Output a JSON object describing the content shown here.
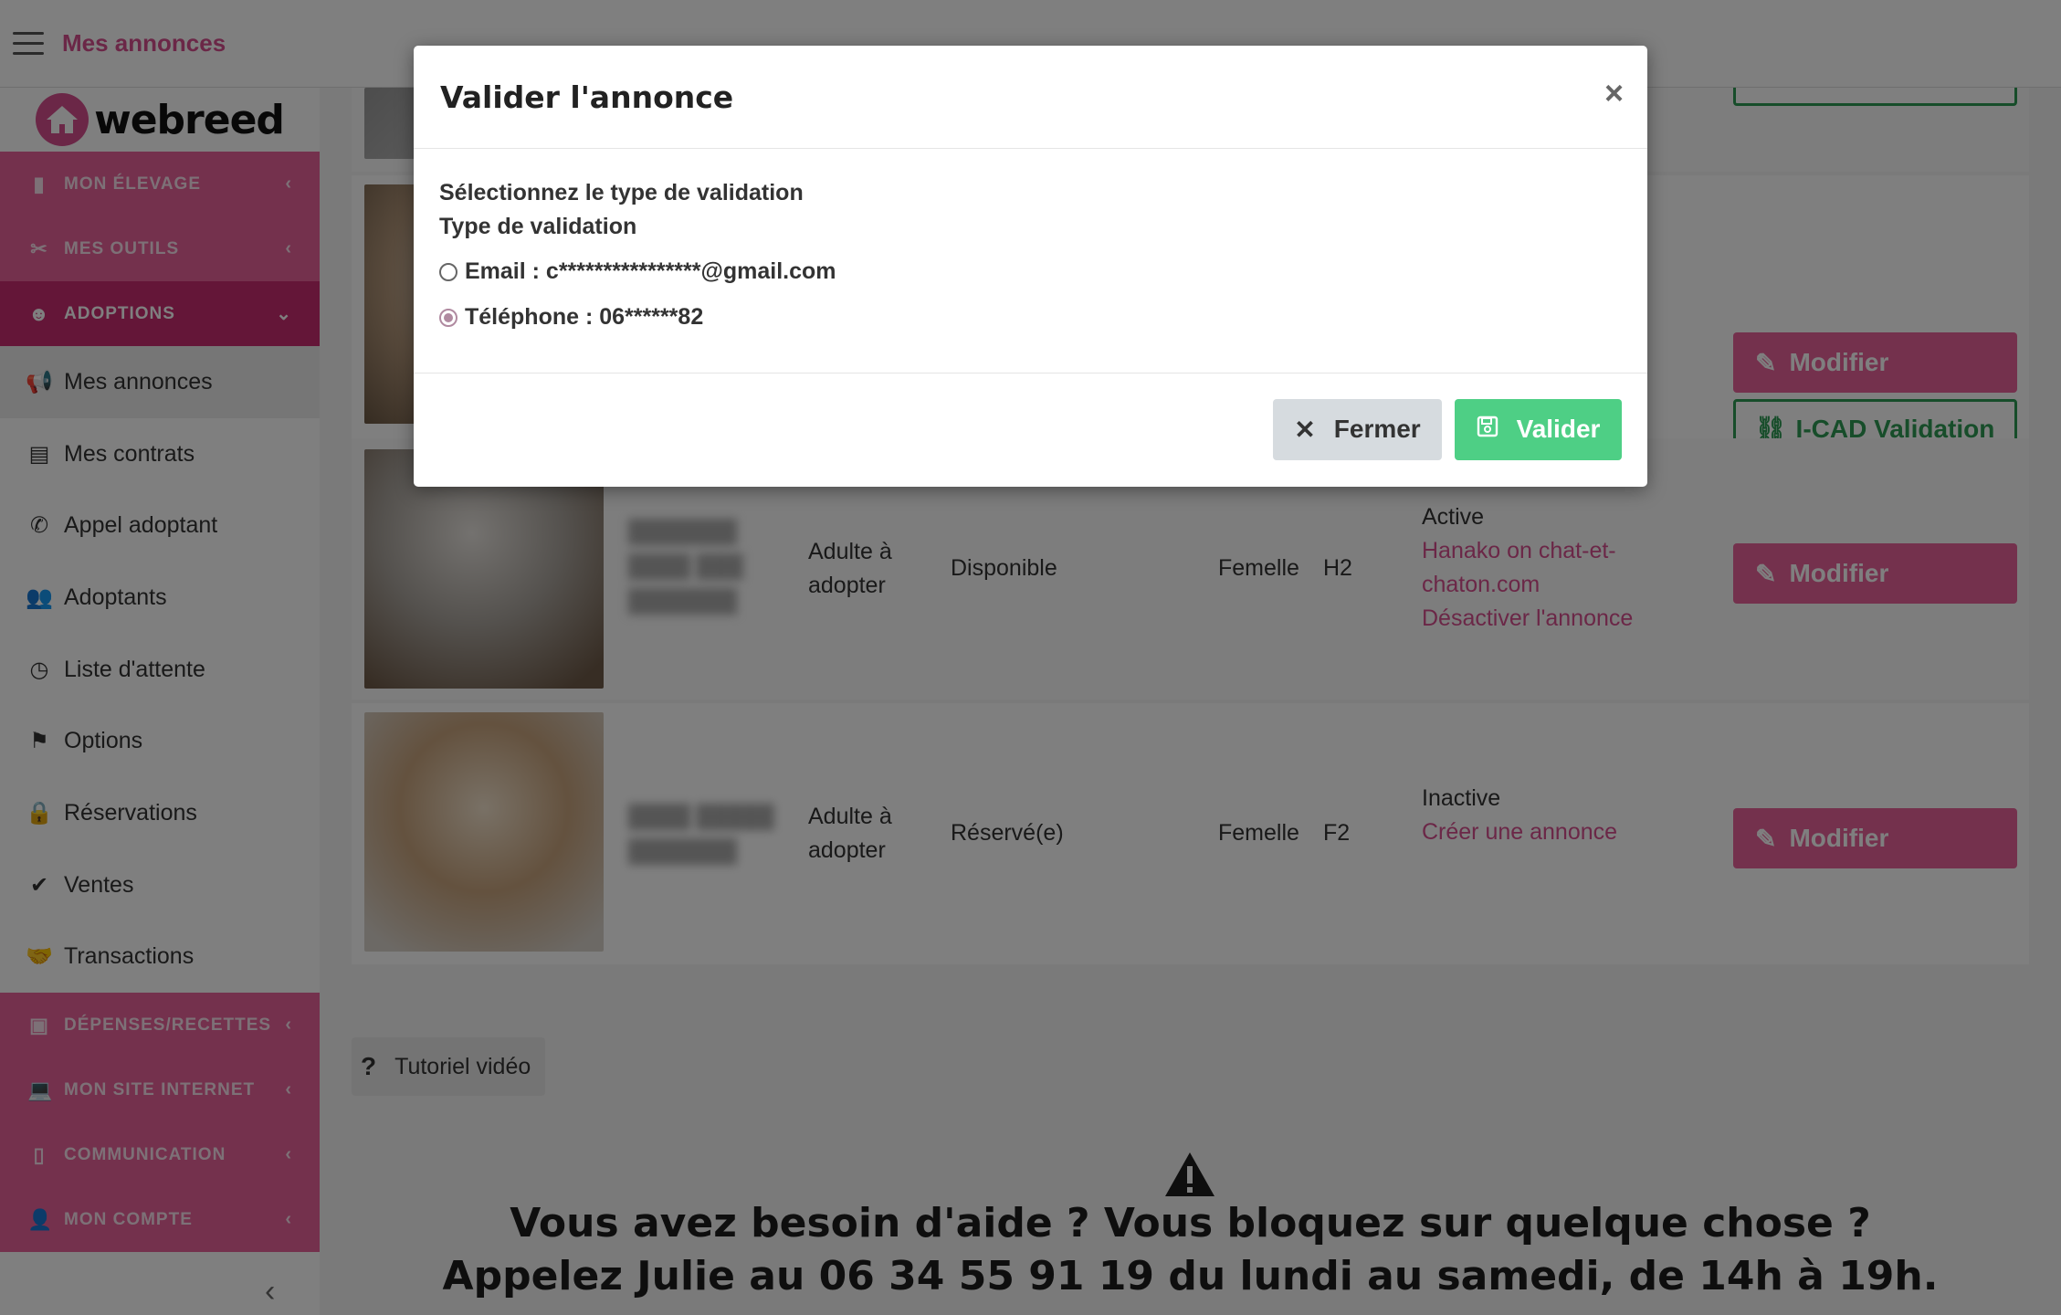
{
  "topbar": {
    "title": "Mes annonces"
  },
  "logo": {
    "text": "webreed"
  },
  "sidebar": {
    "sections_top": [
      {
        "label": "MON ÉLEVAGE",
        "icon": "bookmark-icon"
      },
      {
        "label": "MES OUTILS",
        "icon": "tools-icon"
      },
      {
        "label": "ADOPTIONS",
        "icon": "face-icon"
      }
    ],
    "items": [
      {
        "label": "Mes annonces",
        "icon": "megaphone-icon"
      },
      {
        "label": "Mes contrats",
        "icon": "contract-icon"
      },
      {
        "label": "Appel adoptant",
        "icon": "phone-icon"
      },
      {
        "label": "Adoptants",
        "icon": "users-icon"
      },
      {
        "label": "Liste d'attente",
        "icon": "clock-icon"
      },
      {
        "label": "Options",
        "icon": "flag-icon"
      },
      {
        "label": "Réservations",
        "icon": "lock-icon"
      },
      {
        "label": "Ventes",
        "icon": "check-icon"
      },
      {
        "label": "Transactions",
        "icon": "handshake-icon"
      }
    ],
    "sections_bottom": [
      {
        "label": "DÉPENSES/RECETTES",
        "icon": "book-icon"
      },
      {
        "label": "MON SITE INTERNET",
        "icon": "laptop-icon"
      },
      {
        "label": "COMMUNICATION",
        "icon": "mobile-icon"
      },
      {
        "label": "MON COMPTE",
        "icon": "user-icon"
      }
    ]
  },
  "listing": {
    "modify_label": "Modifier",
    "icad_label": "I-CAD Validation",
    "rows": [
      {
        "category": "Adulte à adopter",
        "status": "Disponible",
        "sex": "Femelle",
        "code": "H2",
        "state": "Active",
        "links": [
          "Hanako on chat-et-chaton.com",
          "Désactiver l'annonce"
        ]
      },
      {
        "category": "Adulte à adopter",
        "status": "Réservé(e)",
        "sex": "Femelle",
        "code": "F2",
        "state": "Inactive",
        "links": [
          "Créer une annonce"
        ]
      }
    ]
  },
  "tutorial": {
    "icon": "?",
    "label": "Tutoriel vidéo"
  },
  "help": {
    "line1": "Vous avez besoin d'aide ? Vous bloquez sur quelque chose ?",
    "line2": "Appelez Julie au 06 34 55 91 19 du lundi au samedi, de 14h à 19h."
  },
  "modal": {
    "title": "Valider l'annonce",
    "close": "×",
    "prompt": "Sélectionnez le type de validation",
    "field_label": "Type de validation",
    "options": [
      {
        "label": "Email : c****************@gmail.com",
        "checked": false
      },
      {
        "label": "Téléphone : 06******82",
        "checked": true
      }
    ],
    "close_button": "Fermer",
    "submit_button": "Valider"
  }
}
